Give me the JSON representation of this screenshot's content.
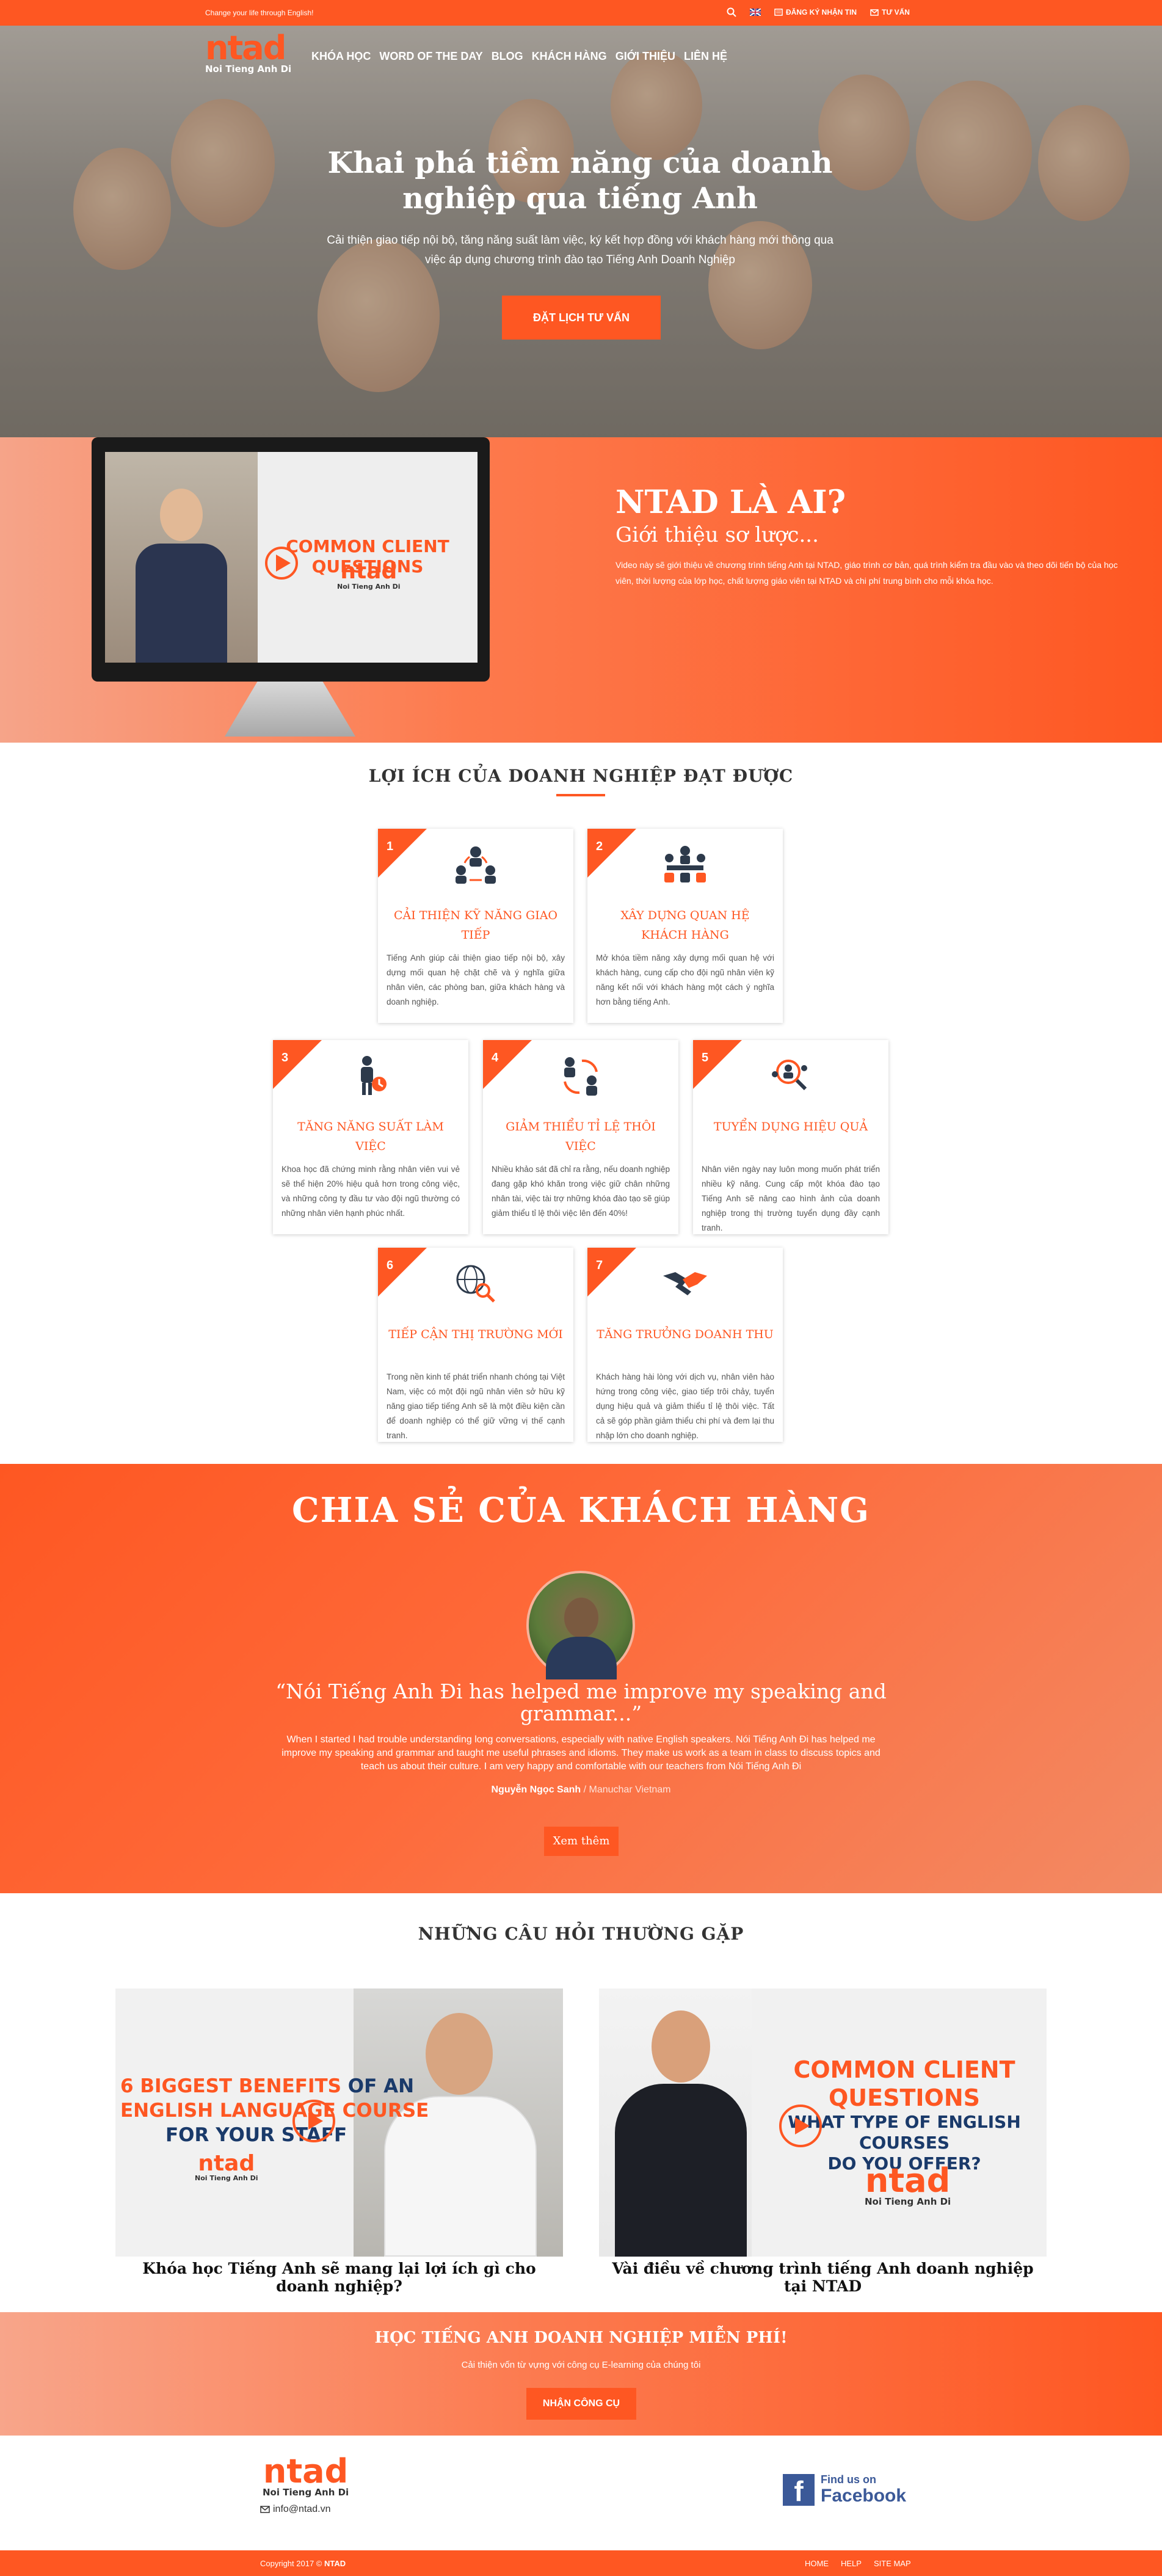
{
  "topbar": {
    "tagline": "Change your life through English!",
    "signup": "ĐĂNG KÝ NHẬN TIN",
    "advice": "TƯ VẤN"
  },
  "brand": {
    "logo": "ntad",
    "logo_sub": "Noi Tieng Anh Di"
  },
  "nav": {
    "items": [
      "KHÓA HỌC",
      "WORD OF THE DAY",
      "BLOG",
      "KHÁCH HÀNG",
      "GIỚI THIỆU",
      "LIÊN HỆ"
    ]
  },
  "hero": {
    "title": "Khai phá tiềm năng của doanh nghiệp qua tiếng Anh",
    "subtitle": "Cải thiện giao tiếp nội bộ, tăng năng suất làm việc, ký kết hợp đồng với khách hàng mới thông qua việc áp dụng chương trình đào tạo Tiếng Anh Doanh Nghiệp",
    "cta": "ĐẶT LỊCH TƯ VẤN"
  },
  "who": {
    "title": "NTAD LÀ AI?",
    "subtitle": "Giới thiệu sơ lược...",
    "text": "Video này sẽ giới thiệu về chương trình tiếng Anh tại NTAD, giáo trình cơ bản, quá trình kiểm tra đầu vào và theo dõi tiến bộ của học viên, thời lượng của lớp học, chất lượng giáo viên tại NTAD và chi phí trung bình cho mỗi khóa học.",
    "video_title": "COMMON CLIENT QUESTIONS",
    "video_logo": "ntad",
    "video_logo_sub": "Noi Tieng Anh Di"
  },
  "benefits": {
    "title": "LỢI ÍCH CỦA DOANH NGHIỆP ĐẠT ĐƯỢC",
    "items": [
      {
        "num": "1",
        "icon": "team-communication-icon",
        "title": "CẢI THIỆN KỸ NĂNG GIAO TIẾP",
        "text": "Tiếng Anh giúp cải thiện giao tiếp nội bộ, xây dựng mối quan hệ chặt chẽ và ý nghĩa giữa nhân viên, các phòng ban, giữa khách hàng và doanh nghiệp."
      },
      {
        "num": "2",
        "icon": "meeting-icon",
        "title": "XÂY DỰNG QUAN HỆ KHÁCH HÀNG",
        "text": "Mở khóa tiềm năng xây dựng mối quan hệ với khách hàng, cung cấp cho đội ngũ nhân viên kỹ năng kết nối với khách hàng một cách ý nghĩa hơn bằng tiếng Anh."
      },
      {
        "num": "3",
        "icon": "productivity-icon",
        "title": "TĂNG NĂNG SUẤT LÀM VIỆC",
        "text": "Khoa học đã chứng minh rằng nhân viên vui vẻ sẽ thể hiện 20% hiệu quả hơn trong công việc, và những công ty đầu tư vào đội ngũ thường có những nhân viên hạnh phúc nhất."
      },
      {
        "num": "4",
        "icon": "turnover-icon",
        "title": "GIẢM THIỂU TỈ LỆ THÔI VIỆC",
        "text": "Nhiều khảo sát đã chỉ ra rằng, nếu doanh nghiệp đang gặp khó khăn trong việc giữ chân những nhân tài, việc tài trợ những khóa đào tạo sẽ giúp giảm thiểu tỉ lệ thôi việc lên đến 40%!"
      },
      {
        "num": "5",
        "icon": "recruitment-icon",
        "title": "TUYỂN DỤNG HIỆU QUẢ",
        "text": "Nhân viên ngày nay luôn mong muốn phát triển nhiều kỹ năng. Cung cấp một khóa đào tạo Tiếng Anh sẽ nâng cao hình ảnh của doanh nghiệp trong thị trường tuyển dụng đầy cạnh tranh."
      },
      {
        "num": "6",
        "icon": "global-market-icon",
        "title": "TIẾP CẬN THỊ TRƯỜNG MỚI",
        "text": "Trong nền kinh tế phát triển nhanh chóng tại Việt Nam, việc có một đội ngũ nhân viên sở hữu kỹ năng giao tiếp tiếng Anh sẽ là một điều kiện cần để doanh nghiệp có thể giữ vững vị thế cạnh tranh."
      },
      {
        "num": "7",
        "icon": "handshake-icon",
        "title": "TĂNG TRƯỞNG DOANH THU",
        "text": "Khách hàng hài lòng với dịch vụ, nhân viên hào hứng trong công việc, giao tiếp trôi chảy, tuyển dụng hiệu quả và giảm thiểu tỉ lệ thôi việc. Tất cả sẽ góp phần giảm thiểu chi phí và đem lại thu nhập lớn cho doanh nghiệp."
      }
    ]
  },
  "testimonials": {
    "title": "CHIA SẺ CỦA KHÁCH HÀNG",
    "quote": "“Nói Tiếng Anh Đi has helped me improve my speaking and grammar...”",
    "text": "When I started I had trouble understanding long conversations, especially with native English speakers. Nói Tiếng Anh Đi has helped me improve my speaking and grammar and taught me useful phrases and idioms. They make us work as a team in class to discuss topics and teach us about their culture. I am very happy and comfortable with our teachers from Nói Tiếng Anh Đi",
    "author": "Nguyễn Ngọc Sanh",
    "company": " / Manuchar Vietnam",
    "button": "Xem thêm"
  },
  "faq": {
    "title": "NHỮNG CÂU HỎI THƯỜNG GẶP",
    "videos": [
      {
        "line1a": "6 BIGGEST BENEFITS",
        "line1b": " OF AN",
        "line2": "ENGLISH LANGUAGE COURSE",
        "line3": "FOR YOUR STAFF",
        "logo": "ntad",
        "logo_sub": "Noi Tieng Anh Di",
        "caption": "Khóa học Tiếng Anh sẽ mang lại lợi ích gì cho doanh nghiệp?"
      },
      {
        "line1": "COMMON CLIENT QUESTIONS",
        "line2": "WHAT TYPE OF ENGLISH COURSES",
        "line3": "DO YOU OFFER?",
        "logo": "ntad",
        "logo_sub": "Noi Tieng Anh Di",
        "caption": "Vài điều về chương trình tiếng Anh doanh nghiệp tại NTAD"
      }
    ]
  },
  "cta": {
    "title": "HỌC TIẾNG ANH DOANH NGHIỆP MIỄN PHÍ!",
    "subtitle": "Cải thiện vốn từ vựng với công cụ E-learning của chúng tôi",
    "button": "NHẬN CÔNG CỤ"
  },
  "footer": {
    "logo": "ntad",
    "logo_sub": "Noi Tieng Anh Di",
    "email": "info@ntad.vn",
    "fb_line1": "Find us on",
    "fb_line2": "Facebook",
    "copyright": "Copyright 2017 © ",
    "copyright_brand": "NTAD",
    "links": [
      "HOME",
      "HELP",
      "SITE MAP"
    ]
  },
  "colors": {
    "accent": "#fe5722",
    "facebook": "#3b5998"
  }
}
